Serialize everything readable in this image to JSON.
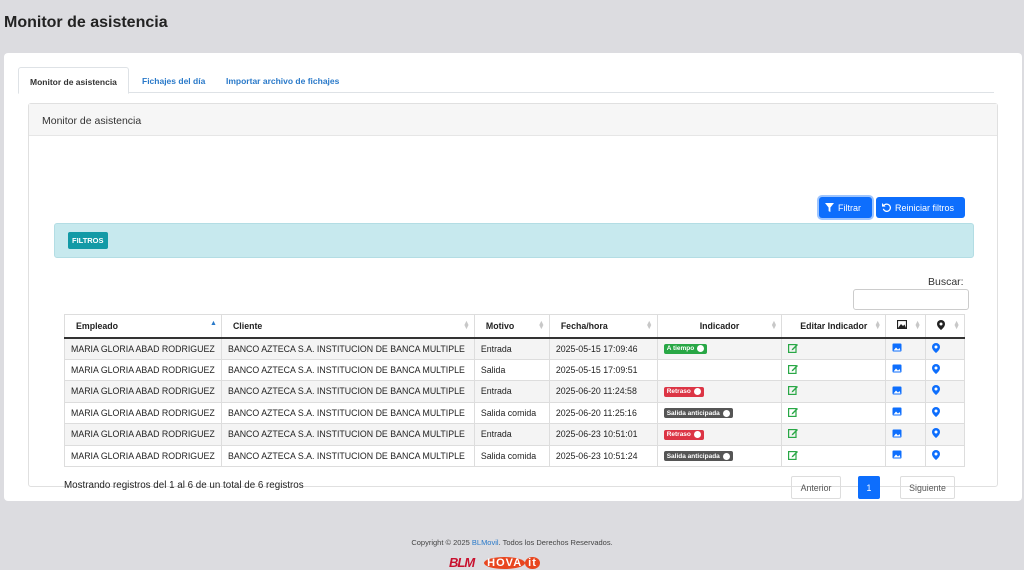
{
  "page_title": "Monitor de asistencia",
  "tabs": [
    {
      "label": "Monitor de asistencia"
    },
    {
      "label": "Fichajes del día"
    },
    {
      "label": "Importar archivo de fichajes"
    }
  ],
  "card_title": "Monitor de asistencia",
  "buttons": {
    "filter": "Filtrar",
    "reset": "Reiniciar filtros"
  },
  "filters_label": "FILTROS",
  "search": {
    "label": "Buscar:",
    "value": ""
  },
  "table": {
    "headers": [
      "Empleado",
      "Cliente",
      "Motivo",
      "Fecha/hora",
      "Indicador",
      "Editar Indicador"
    ],
    "rows": [
      {
        "empleado": "MARIA GLORIA ABAD RODRIGUEZ",
        "cliente": "BANCO AZTECA S.A. INSTITUCION DE BANCA MULTIPLE",
        "motivo": "Entrada",
        "fecha": "2025-05-15 17:09:46",
        "indicador": "A tiempo"
      },
      {
        "empleado": "MARIA GLORIA ABAD RODRIGUEZ",
        "cliente": "BANCO AZTECA S.A. INSTITUCION DE BANCA MULTIPLE",
        "motivo": "Salida",
        "fecha": "2025-05-15 17:09:51",
        "indicador": ""
      },
      {
        "empleado": "MARIA GLORIA ABAD RODRIGUEZ",
        "cliente": "BANCO AZTECA S.A. INSTITUCION DE BANCA MULTIPLE",
        "motivo": "Entrada",
        "fecha": "2025-06-20 11:24:58",
        "indicador": "Retraso"
      },
      {
        "empleado": "MARIA GLORIA ABAD RODRIGUEZ",
        "cliente": "BANCO AZTECA S.A. INSTITUCION DE BANCA MULTIPLE",
        "motivo": "Salida comida",
        "fecha": "2025-06-20 11:25:16",
        "indicador": "Salida anticipada"
      },
      {
        "empleado": "MARIA GLORIA ABAD RODRIGUEZ",
        "cliente": "BANCO AZTECA S.A. INSTITUCION DE BANCA MULTIPLE",
        "motivo": "Entrada",
        "fecha": "2025-06-23 10:51:01",
        "indicador": "Retraso"
      },
      {
        "empleado": "MARIA GLORIA ABAD RODRIGUEZ",
        "cliente": "BANCO AZTECA S.A. INSTITUCION DE BANCA MULTIPLE",
        "motivo": "Salida comida",
        "fecha": "2025-06-23 10:51:24",
        "indicador": "Salida anticipada"
      }
    ]
  },
  "info": "Mostrando registros del 1 al 6 de un total de 6 registros",
  "pagination": {
    "prev": "Anterior",
    "current": "1",
    "next": "Siguiente"
  },
  "footer": {
    "prefix": "Copyright © 2025 ",
    "link": "BLMovil",
    "suffix": ". Todos los Derechos Reservados.",
    "logo_blm": "BLM",
    "logo_hova": "HOVA",
    "logo_hova_mark": "it"
  },
  "colors": {
    "primary": "#0d6efd",
    "success": "#28a745",
    "danger": "#dc3545",
    "secondary": "#555555",
    "info_bg": "#c7e9ee",
    "chip": "#139aa6"
  }
}
